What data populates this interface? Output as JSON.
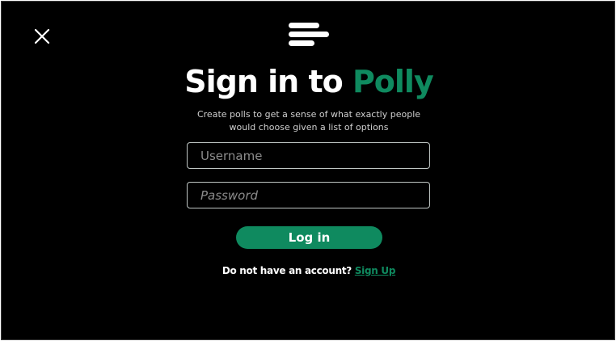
{
  "header": {
    "close_icon": "close-icon",
    "logo_icon": "menu-lines-logo-icon"
  },
  "title": {
    "prefix": "Sign in to ",
    "brand": "Polly"
  },
  "subtitle": "Create polls to get a sense of what exactly people would choose given a list of options",
  "form": {
    "username_placeholder": "Username",
    "password_placeholder": "Password",
    "login_label": "Log in"
  },
  "signup": {
    "prompt": "Do not have an account? ",
    "link_label": "Sign Up"
  },
  "colors": {
    "background": "#000000",
    "accent": "#0f8a5f",
    "text": "#ffffff",
    "field_border": "#bfc6c4"
  }
}
